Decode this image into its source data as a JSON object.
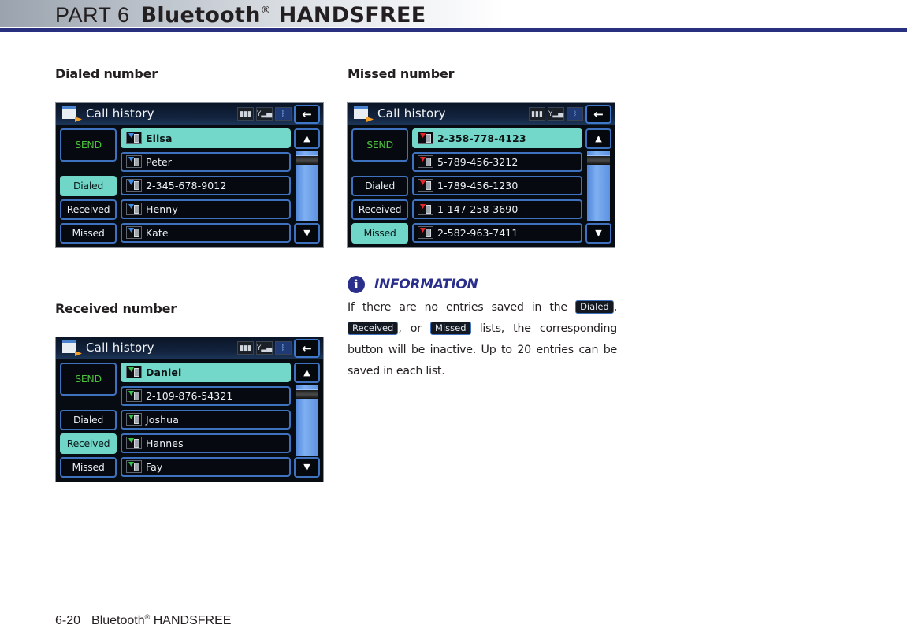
{
  "header": {
    "part": "PART 6",
    "chapter": "Bluetooth",
    "chapter_mark": "®",
    "chapter_rest": " HANDSFREE"
  },
  "colors": {
    "header_rule": "#2a3080",
    "info_accent": "#2b2f8c",
    "active_button": "#6fd6c8",
    "button_border": "#3e72bf",
    "send_text": "#4dc23d",
    "dialed_indicator": "#3f8be6",
    "received_indicator": "#39c24a",
    "missed_indicator": "#e3262b"
  },
  "sections": [
    {
      "heading": "Dialed number",
      "screen": {
        "title": "Call history",
        "status_icons": [
          "battery-icon",
          "signal-icon",
          "bluetooth-icon"
        ],
        "back_label": "←",
        "send_label": "SEND",
        "buttons": [
          "Dialed",
          "Received",
          "Missed"
        ],
        "active": "Dialed",
        "entry_icon": "dialed-call-icon",
        "entries": [
          "Elisa",
          "Peter",
          "2-345-678-9012",
          "Henny",
          "Kate"
        ],
        "selected_index": 0
      }
    },
    {
      "heading": "Missed number",
      "screen": {
        "title": "Call history",
        "status_icons": [
          "battery-icon",
          "signal-icon",
          "bluetooth-icon"
        ],
        "back_label": "←",
        "send_label": "SEND",
        "buttons": [
          "Dialed",
          "Received",
          "Missed"
        ],
        "active": "Missed",
        "entry_icon": "missed-call-icon",
        "entries": [
          "2-358-778-4123",
          "5-789-456-3212",
          "1-789-456-1230",
          "1-147-258-3690",
          "2-582-963-7411"
        ],
        "selected_index": 0
      }
    },
    {
      "heading": "Received number",
      "screen": {
        "title": "Call history",
        "status_icons": [
          "battery-icon",
          "signal-icon",
          "bluetooth-icon"
        ],
        "back_label": "←",
        "send_label": "SEND",
        "buttons": [
          "Dialed",
          "Received",
          "Missed"
        ],
        "active": "Received",
        "entry_icon": "received-call-icon",
        "entries": [
          "Daniel",
          "2-109-876-54321",
          "Joshua",
          "Hannes",
          "Fay"
        ],
        "selected_index": 0
      }
    }
  ],
  "scroll": {
    "up_label": "▲",
    "down_label": "▼"
  },
  "information": {
    "icon": "i",
    "title": "INFORMATION",
    "text_1": "If there are no entries saved in the ",
    "chip_dialed": "Dialed",
    "text_2": ", ",
    "chip_received": "Received",
    "text_3": ", or ",
    "chip_missed": "Missed",
    "text_4": " lists, the corresponding button will be inactive. Up to 20 entries can be saved in each list."
  },
  "footer": {
    "page_number": "6-20",
    "chapter": "Bluetooth",
    "chapter_mark": "®",
    "chapter_rest": " HANDSFREE"
  }
}
